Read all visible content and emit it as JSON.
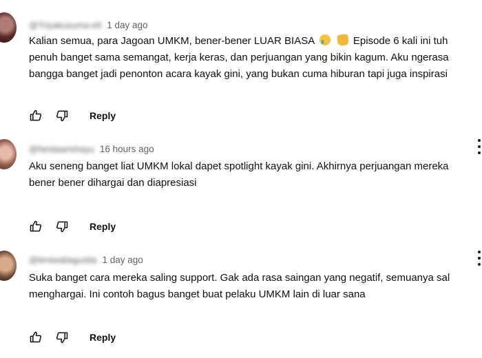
{
  "comments": [
    {
      "handle": "@Triyakusuma-elt",
      "time": "1 day ago",
      "lines": [
        "Kalian semua, para Jagoan UMKM, bener-bener LUAR BIASA",
        "Episode 6 kali ini tuh",
        "penuh banget sama semangat, kerja keras, dan perjuangan yang bikin kagum. Aku ngerasa",
        "bangga banget jadi penonton acara kayak gini, yang bukan cuma hiburan tapi juga inspirasi"
      ],
      "emojis": [
        "loudly-crying-face",
        "raising-hands"
      ],
      "reply_label": "Reply"
    },
    {
      "handle": "@faridaarishayu",
      "time": "16 hours ago",
      "lines": [
        "Aku seneng banget liat UMKM lokal dapet spotlight kayak gini. Akhirnya perjuangan mereka",
        "bener bener dihargai dan diapresiasi"
      ],
      "reply_label": "Reply"
    },
    {
      "handle": "@leniwatiagustia",
      "time": "1 day ago",
      "lines": [
        "Suka banget cara mereka saling support. Gak ada rasa saingan yang negatif, semuanya sal",
        "menghargai. Ini contoh bagus banget buat pelaku UMKM lain di luar sana"
      ],
      "reply_label": "Reply"
    }
  ],
  "icons": {
    "like": "thumbs-up-icon",
    "dislike": "thumbs-down-icon",
    "menu": "more-vertical-icon"
  }
}
